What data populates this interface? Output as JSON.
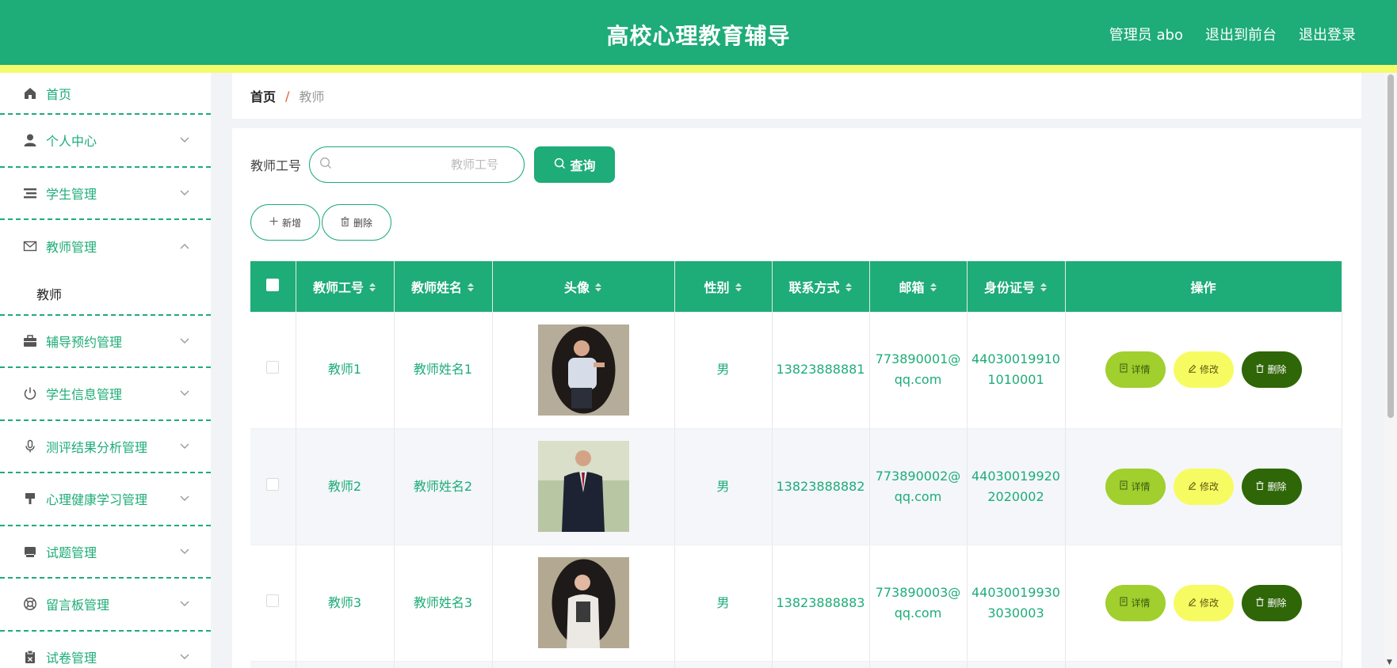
{
  "header": {
    "title": "高校心理教育辅导",
    "admin": "管理员 abo",
    "to_front": "退出到前台",
    "logout": "退出登录"
  },
  "sidebar": {
    "home": "首页",
    "items": [
      {
        "label": "个人中心",
        "icon": "user-icon"
      },
      {
        "label": "学生管理",
        "icon": "list-icon"
      },
      {
        "label": "教师管理",
        "icon": "mail-icon",
        "expanded": true,
        "children": [
          "教师"
        ]
      },
      {
        "label": "辅导预约管理",
        "icon": "briefcase-icon"
      },
      {
        "label": "学生信息管理",
        "icon": "power-icon"
      },
      {
        "label": "测评结果分析管理",
        "icon": "microphone-icon"
      },
      {
        "label": "心理健康学习管理",
        "icon": "brush-icon"
      },
      {
        "label": "试题管理",
        "icon": "printer-icon"
      },
      {
        "label": "留言板管理",
        "icon": "lifebuoy-icon"
      },
      {
        "label": "试卷管理",
        "icon": "clipboard-icon"
      }
    ]
  },
  "breadcrumb": {
    "home": "首页",
    "sep": "/",
    "current": "教师"
  },
  "search": {
    "label": "教师工号",
    "placeholder": "教师工号",
    "button": "查询"
  },
  "actions": {
    "add": "新增",
    "delete": "删除"
  },
  "table": {
    "headers": [
      "教师工号",
      "教师姓名",
      "头像",
      "性别",
      "联系方式",
      "邮箱",
      "身份证号",
      "操作"
    ],
    "rows": [
      {
        "id": "教师1",
        "name": "教师姓名1",
        "gender": "男",
        "phone": "13823888881",
        "email_a": "773890001@",
        "email_b": "qq.com",
        "idcard_a": "44030019910",
        "idcard_b": "1010001"
      },
      {
        "id": "教师2",
        "name": "教师姓名2",
        "gender": "男",
        "phone": "13823888882",
        "email_a": "773890002@",
        "email_b": "qq.com",
        "idcard_a": "44030019920",
        "idcard_b": "2020002"
      },
      {
        "id": "教师3",
        "name": "教师姓名3",
        "gender": "男",
        "phone": "13823888883",
        "email_a": "773890003@",
        "email_b": "qq.com",
        "idcard_a": "44030019930",
        "idcard_b": "3030003"
      }
    ],
    "ops": {
      "detail": "详情",
      "edit": "修改",
      "delete": "删除"
    }
  },
  "colors": {
    "primary": "#1eac78",
    "stripe": "#f4fb6c",
    "detail": "#a0cf2e",
    "edit": "#f7fb62",
    "del": "#2f6608"
  }
}
